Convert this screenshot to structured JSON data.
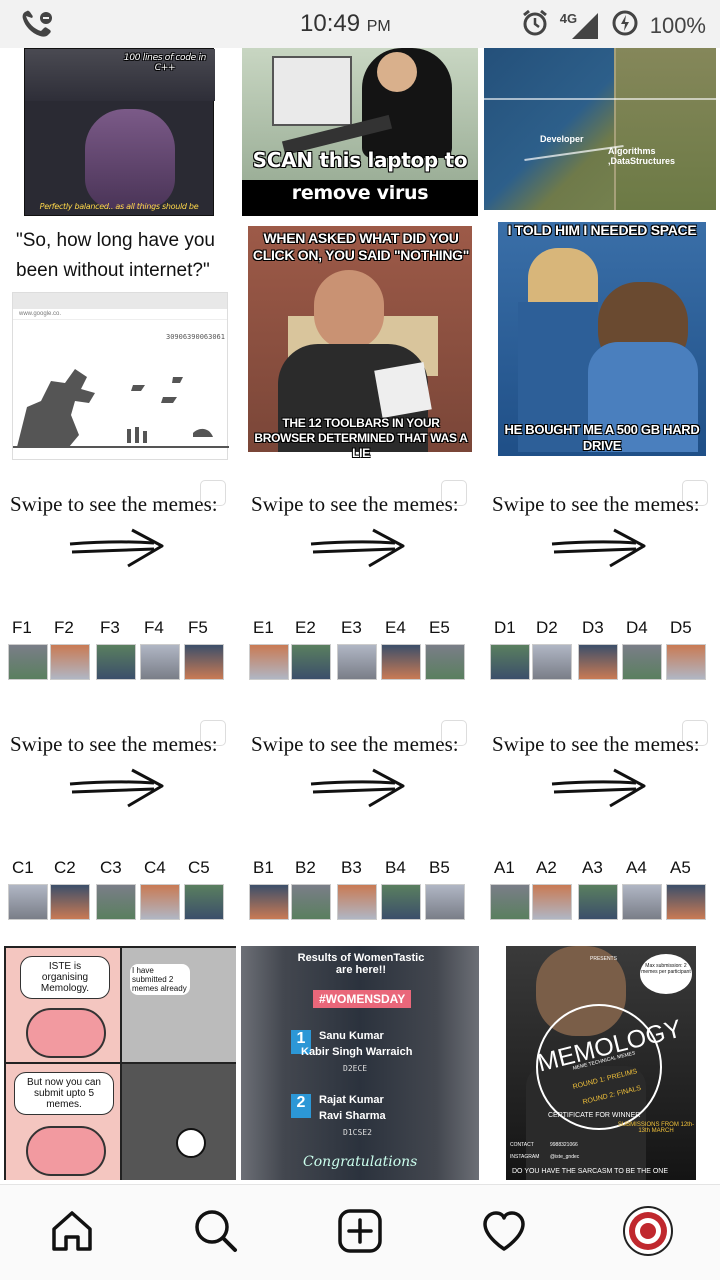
{
  "status_bar": {
    "time": "10:49",
    "ampm": "PM",
    "network": "4G",
    "battery": "100%"
  },
  "memes": {
    "r1c1_top": "100 lines of code in C++",
    "r1c1_bottom": "Perfectly balanced.. as all things should be",
    "r1c2_line1": "SCAN this laptop to",
    "r1c2_line2": "remove virus",
    "r1c3_label1": "Developer",
    "r1c3_label2": "Algorithms ,DataStructures",
    "r2c1_question": "\"So, how long have you been without internet?\"",
    "r2c1_url": "www.google.co.",
    "r2c1_score": "30906390063061",
    "r2c2_top": "WHEN ASKED WHAT DID YOU CLICK ON, YOU SAID \"NOTHING\"",
    "r2c2_bottom": "THE 12 TOOLBARS IN YOUR BROWSER DETERMINED THAT WAS A LIE",
    "r2c3_top": "I TOLD HIM I NEEDED SPACE",
    "r2c3_bottom": "HE BOUGHT ME A 500 GB HARD DRIVE"
  },
  "swipe_text": "Swipe to see the memes:",
  "thumb_groups": [
    [
      "F1",
      "F2",
      "F3",
      "F4",
      "F5"
    ],
    [
      "E1",
      "E2",
      "E3",
      "E4",
      "E5"
    ],
    [
      "D1",
      "D2",
      "D3",
      "D4",
      "D5"
    ],
    [
      "C1",
      "C2",
      "C3",
      "C4",
      "C5"
    ],
    [
      "B1",
      "B2",
      "B3",
      "B4",
      "B5"
    ],
    [
      "A1",
      "A2",
      "A3",
      "A4",
      "A5"
    ]
  ],
  "posters": {
    "comic_panel1": "ISTE is organising Memology.",
    "comic_panel2": "I have submitted 2 memes already",
    "comic_panel3": "But now you can submit upto 5 memes.",
    "results_title": "Results of WomenTastic are here!!",
    "results_tag": "#WOMENSDAY",
    "results_1_name1": "Sanu Kumar",
    "results_1_name2": "Kabir Singh Warraich",
    "results_1_class": "D2ECE",
    "results_2_name1": "Rajat Kumar",
    "results_2_name2": "Ravi Sharma",
    "results_2_class": "D1CSE2",
    "results_congrats": "Congratulations",
    "memology_presents": "PRESENTS",
    "memology_bubble": "Max submission: 2 memes per participant",
    "memology_title": "MEMOLOGY",
    "memology_sub": "MEME TECHNICAL MEMES",
    "memology_round1": "ROUND 1: PRELIMS",
    "memology_round2": "ROUND 2: FINALS",
    "memology_cert": "CERTIFICATE FOR WINNER",
    "memology_dates": "SUBMISSIONS FROM 12th-13th MARCH",
    "memology_contact": "CONTACT",
    "memology_phone": "9988321066",
    "memology_instagram": "INSTAGRAM",
    "memology_handle": "@iste_gndec",
    "memology_footer": "DO YOU HAVE THE SARCASM TO BE THE ONE"
  },
  "nav": [
    "home-icon",
    "search-icon",
    "add-post-icon",
    "activity-heart-icon",
    "profile-avatar"
  ]
}
